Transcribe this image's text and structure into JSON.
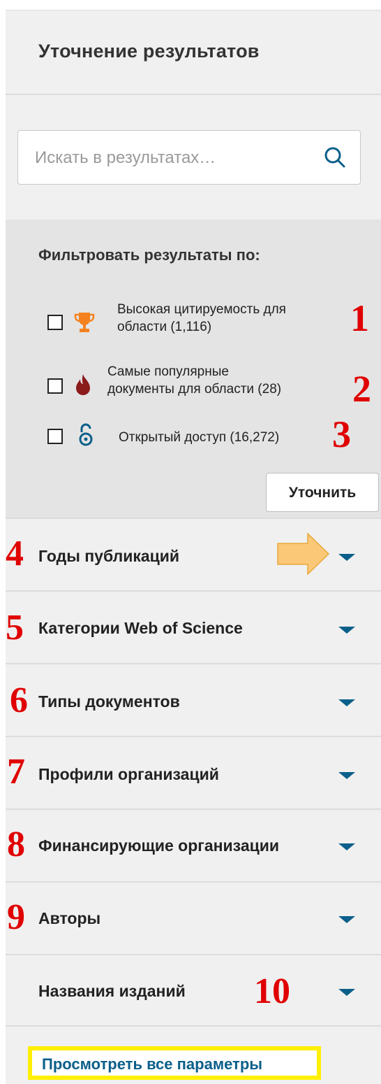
{
  "header": {
    "title": "Уточнение результатов"
  },
  "search": {
    "placeholder": "Искать в результатах…"
  },
  "filters": {
    "title": "Фильтровать результаты по:",
    "items": [
      {
        "line1": "Высокая цитируемость для",
        "line2": "области (1,116)",
        "icon": "trophy-icon",
        "checked": false
      },
      {
        "line1": "Самые популярные",
        "line2": "документы для области (28)",
        "icon": "fire-icon",
        "checked": false
      },
      {
        "line1": "Открытый доступ (16,272)",
        "icon": "open-access-icon",
        "checked": false
      }
    ],
    "refine_label": "Уточнить"
  },
  "sections": [
    {
      "label": "Годы публикаций"
    },
    {
      "label": "Категории Web of Science"
    },
    {
      "label": "Типы документов"
    },
    {
      "label": "Профили организаций"
    },
    {
      "label": "Финансирующие организации"
    },
    {
      "label": "Авторы"
    },
    {
      "label": "Названия изданий"
    }
  ],
  "annotations": [
    "1",
    "2",
    "3",
    "4",
    "5",
    "6",
    "7",
    "8",
    "9",
    "10"
  ],
  "footer": {
    "view_all_label": "Просмотреть все параметры"
  },
  "colors": {
    "accent": "#0b5f8a",
    "annotation": "#e00000",
    "highlight": "#ffef00",
    "trophy": "#f5821f",
    "fire": "#8b1a1a"
  }
}
